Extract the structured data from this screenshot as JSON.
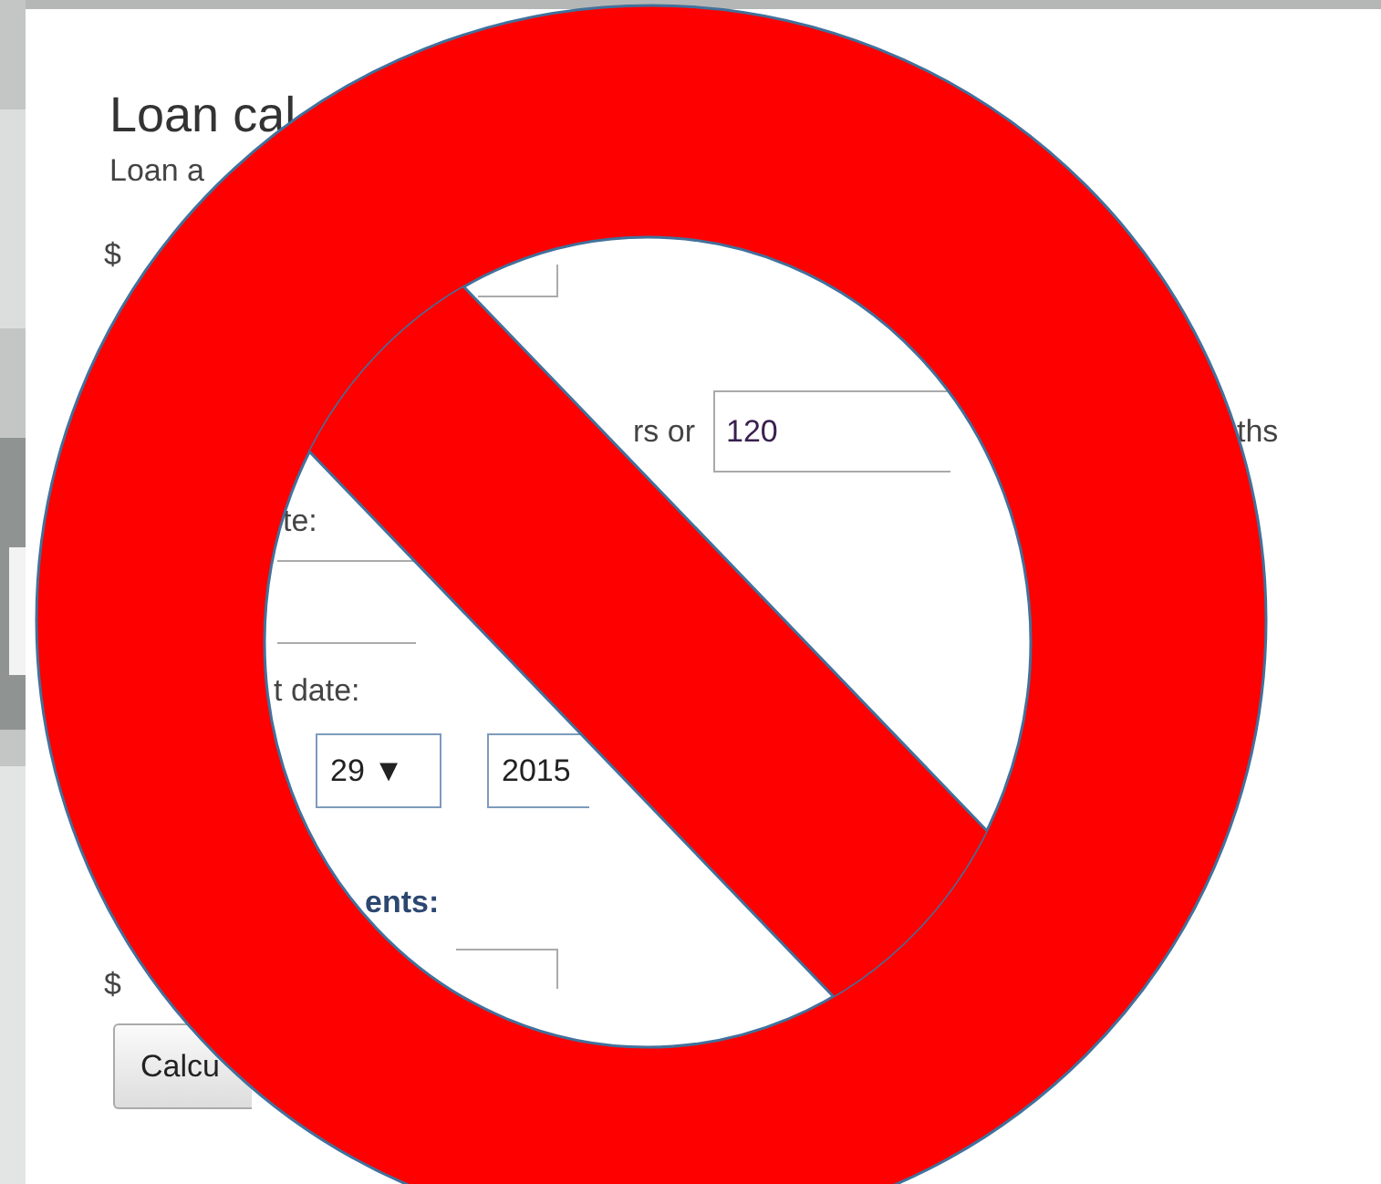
{
  "title": "Loan cal",
  "amount": {
    "label": "Loan a",
    "currency": "$"
  },
  "term": {
    "years_suffix": "rs or",
    "months_value": "120",
    "months_suffix": "ths"
  },
  "rate": {
    "label": "te:"
  },
  "start_date": {
    "label": "t date:",
    "day": "29 ▼",
    "year": "2015"
  },
  "extra_payments": {
    "label": "ents:",
    "currency": "$"
  },
  "button": {
    "label": "Calcu"
  }
}
